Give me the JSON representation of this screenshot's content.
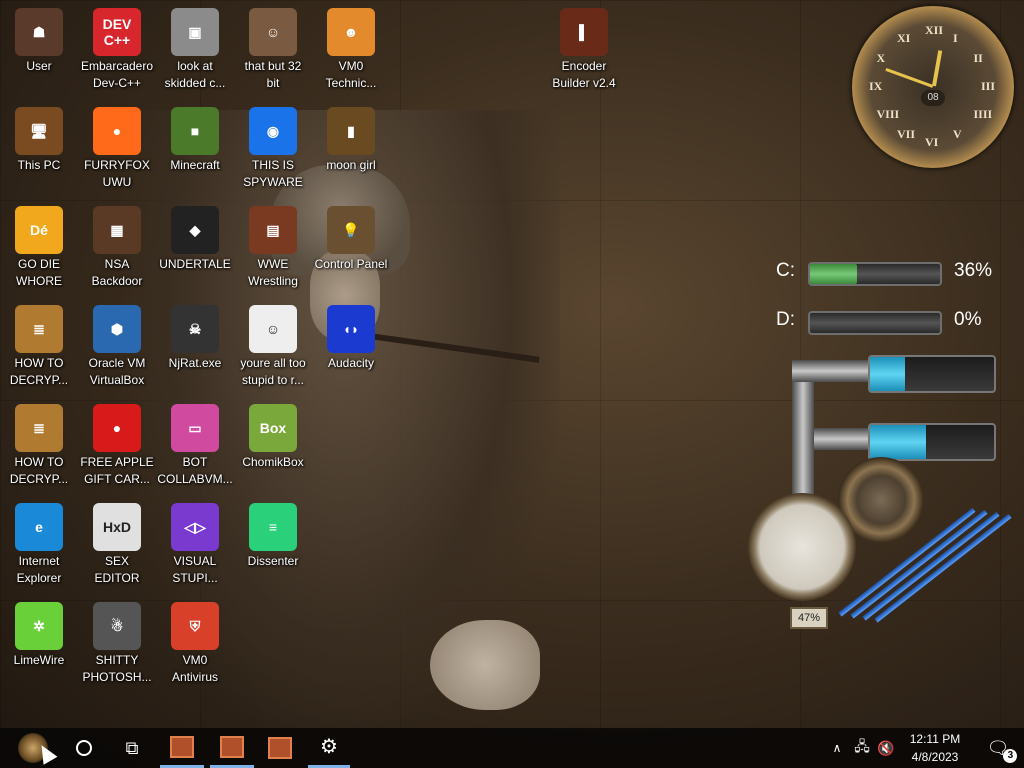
{
  "desktop_icons": [
    {
      "label": "User",
      "glyph": "☗",
      "color": "#5a3a2a"
    },
    {
      "label": "Embarcadero\nDev-C++",
      "glyph": "DEV C++",
      "color": "#d8262d"
    },
    {
      "label": "look at\nskidded c...",
      "glyph": "▣",
      "color": "#8b8b8b"
    },
    {
      "label": "that but 32\nbit",
      "glyph": "☺",
      "color": "#7a5a40"
    },
    {
      "label": "VM0\nTechnic...",
      "glyph": "☻",
      "color": "#e38a2c"
    },
    {
      "label": "Encoder\nBuilder v2.4",
      "glyph": "▌",
      "color": "#6a2a18"
    },
    {
      "label": "This PC",
      "glyph": "🖥",
      "color": "#7a4a20"
    },
    {
      "label": "FURRYFOX\nUWU",
      "glyph": "●",
      "color": "#ff6a1a"
    },
    {
      "label": "Minecraft",
      "glyph": "■",
      "color": "#4a7a2a"
    },
    {
      "label": "THIS IS\nSPYWARE",
      "glyph": "◉",
      "color": "#1a73e8"
    },
    {
      "label": "moon girl",
      "glyph": "▮",
      "color": "#6a4a20"
    },
    {
      "label": "GO DIE\nWHORE",
      "glyph": "Dé",
      "color": "#f2a81d"
    },
    {
      "label": "NSA\nBackdoor",
      "glyph": "▦",
      "color": "#5a3a25"
    },
    {
      "label": "UNDERTALE",
      "glyph": "◆",
      "color": "#222222"
    },
    {
      "label": "WWE\nWrestling",
      "glyph": "▤",
      "color": "#7a3a22"
    },
    {
      "label": "Control Panel",
      "glyph": "💡",
      "color": "#6a5030"
    },
    {
      "label": "HOW TO\nDECRYP...",
      "glyph": "≣",
      "color": "#b07a30"
    },
    {
      "label": "Oracle VM\nVirtualBox",
      "glyph": "⬢",
      "color": "#2a68b0"
    },
    {
      "label": "NjRat.exe",
      "glyph": "☠",
      "color": "#333333"
    },
    {
      "label": "youre all too\nstupid to r...",
      "glyph": "☺",
      "color": "#eeeeee"
    },
    {
      "label": "Audacity",
      "glyph": "◖◗",
      "color": "#1a3ad0"
    },
    {
      "label": "HOW TO\nDECRYP...",
      "glyph": "≣",
      "color": "#b07a30"
    },
    {
      "label": "FREE APPLE\nGIFT CAR...",
      "glyph": "●",
      "color": "#d81a1a"
    },
    {
      "label": "BOT\nCOLLABVM...",
      "glyph": "▭",
      "color": "#d04aa0"
    },
    {
      "label": "ChomikBox",
      "glyph": "Box",
      "color": "#7aa83a"
    },
    {
      "label": "Internet\nExplorer",
      "glyph": "e",
      "color": "#1a8ad8"
    },
    {
      "label": "SEX\nEDITOR",
      "glyph": "HxD",
      "color": "#e0e0e0"
    },
    {
      "label": "VISUAL\nSTUPI...",
      "glyph": "◁▷",
      "color": "#7a3ad0"
    },
    {
      "label": "Dissenter",
      "glyph": "≡",
      "color": "#2ad07a"
    },
    {
      "label": "LimeWire",
      "glyph": "✲",
      "color": "#6ad03a"
    },
    {
      "label": "SHITTY\nPHOTOSH...",
      "glyph": "☃",
      "color": "#555555"
    },
    {
      "label": "VM0\nAntivirus",
      "glyph": "⛨",
      "color": "#d8402a"
    }
  ],
  "clock_widget": {
    "numerals": [
      "XII",
      "I",
      "II",
      "III",
      "IIII",
      "V",
      "VI",
      "VII",
      "VIII",
      "IX",
      "X",
      "XI"
    ],
    "date": "08"
  },
  "drives": [
    {
      "label": "C:",
      "percent_text": "36%",
      "fill": 0.36
    },
    {
      "label": "D:",
      "percent_text": "0%",
      "fill": 0.0
    }
  ],
  "pipe_gadget": {
    "tube1_fill": 0.28,
    "tube2_fill": 0.45,
    "gauge_readout": "47%"
  },
  "taskbar": {
    "start_icon": "steampunk-start-orb-icon",
    "time": "12:11 PM",
    "date": "4/8/2023",
    "notification_count": "3",
    "colors": {
      "active_underline": "#7fb2e6"
    }
  }
}
